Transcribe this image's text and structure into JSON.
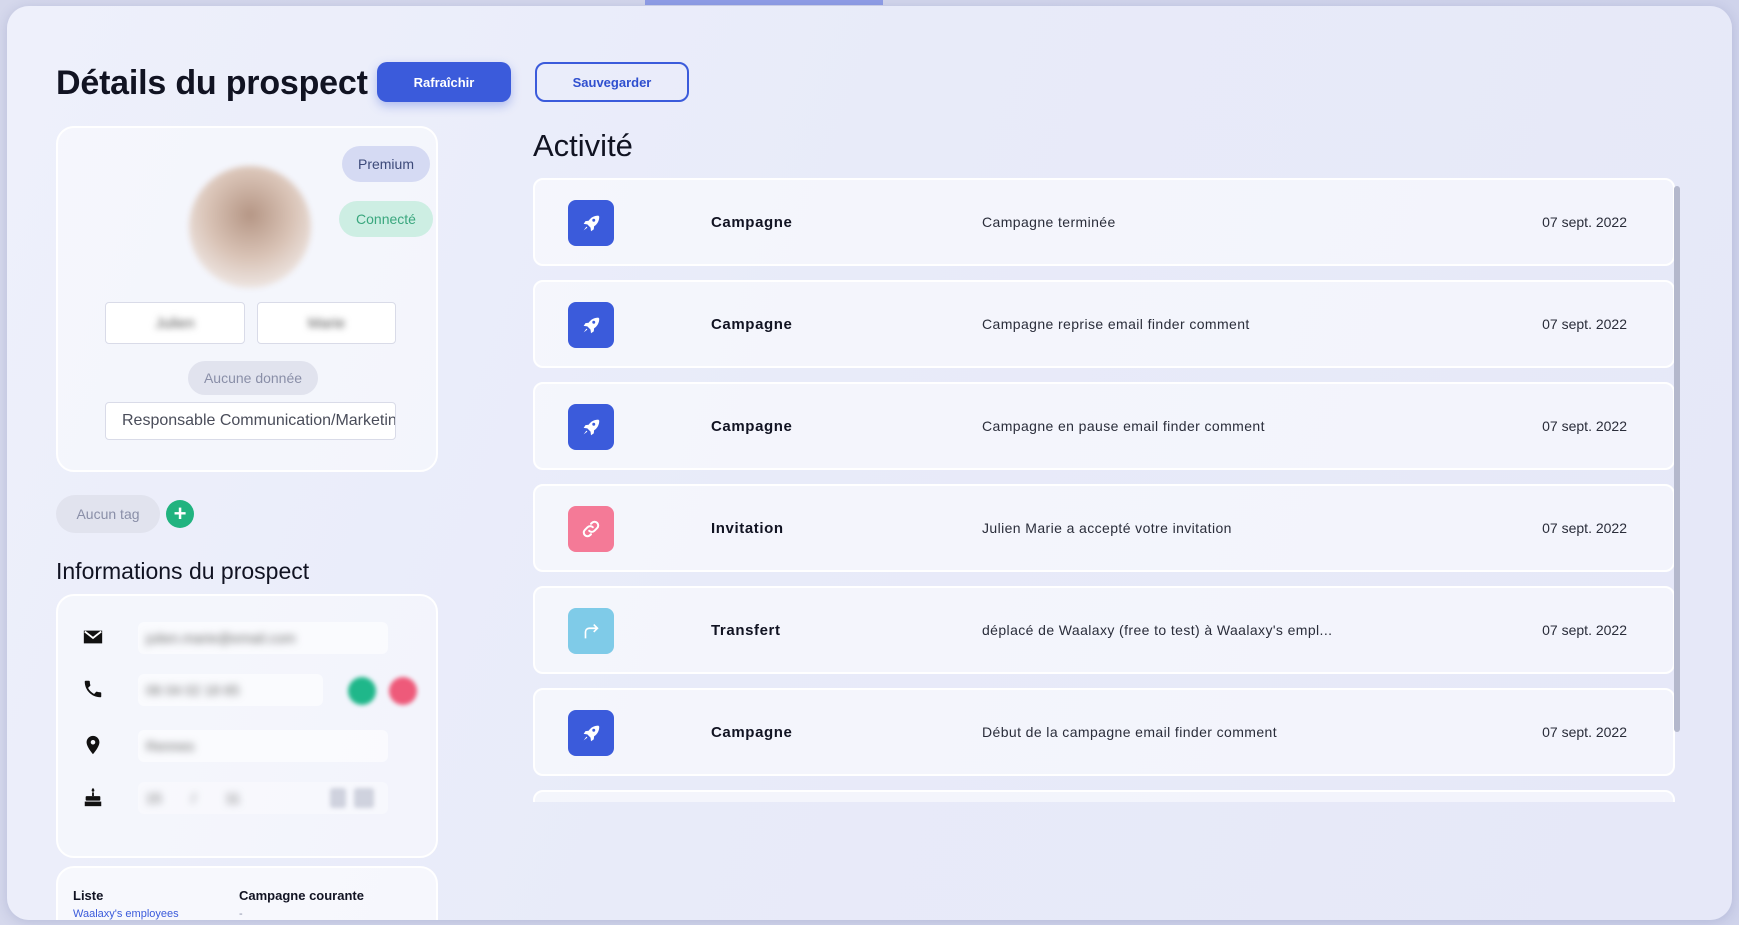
{
  "header": {
    "title": "Détails du prospect",
    "refresh_label": "Rafraîchir",
    "save_label": "Sauvegarder"
  },
  "profile": {
    "badge_premium": "Premium",
    "badge_connected": "Connecté",
    "first_name": "Julien",
    "last_name": "Marie",
    "company_placeholder": "Aucune donnée",
    "job_title": "Responsable Communication/Marketing"
  },
  "tags": {
    "empty_label": "Aucun tag",
    "add_symbol": "+"
  },
  "info": {
    "section_title": "Informations du prospect",
    "email": "julien.marie@email.com",
    "phone": "06 04 02 18 65",
    "location": "Rennes",
    "birthday_day": "15",
    "birthday_separator": "/",
    "birthday_month": "11"
  },
  "list_card": {
    "list_label": "Liste",
    "list_value": "Waalaxy's employees",
    "campaign_label": "Campagne courante",
    "campaign_value": "-"
  },
  "activity": {
    "title": "Activité",
    "rows": [
      {
        "type": "Campagne",
        "description": "Campagne terminée",
        "date": "07 sept. 2022",
        "icon": "rocket-icon",
        "color": "#3b5bdb"
      },
      {
        "type": "Campagne",
        "description": "Campagne reprise email finder comment",
        "date": "07 sept. 2022",
        "icon": "rocket-icon",
        "color": "#3b5bdb"
      },
      {
        "type": "Campagne",
        "description": "Campagne en pause email finder comment",
        "date": "07 sept. 2022",
        "icon": "rocket-icon",
        "color": "#3b5bdb"
      },
      {
        "type": "Invitation",
        "description": "Julien Marie a accepté votre invitation",
        "date": "07 sept. 2022",
        "icon": "link-icon",
        "color": "#f47a97"
      },
      {
        "type": "Transfert",
        "description": "déplacé de Waalaxy (free to test) à Waalaxy's empl...",
        "date": "07 sept. 2022",
        "icon": "forward-arrow-icon",
        "color": "#7fcbe8"
      },
      {
        "type": "Campagne",
        "description": "Début de la campagne email finder comment",
        "date": "07 sept. 2022",
        "icon": "rocket-icon",
        "color": "#3b5bdb"
      }
    ]
  }
}
